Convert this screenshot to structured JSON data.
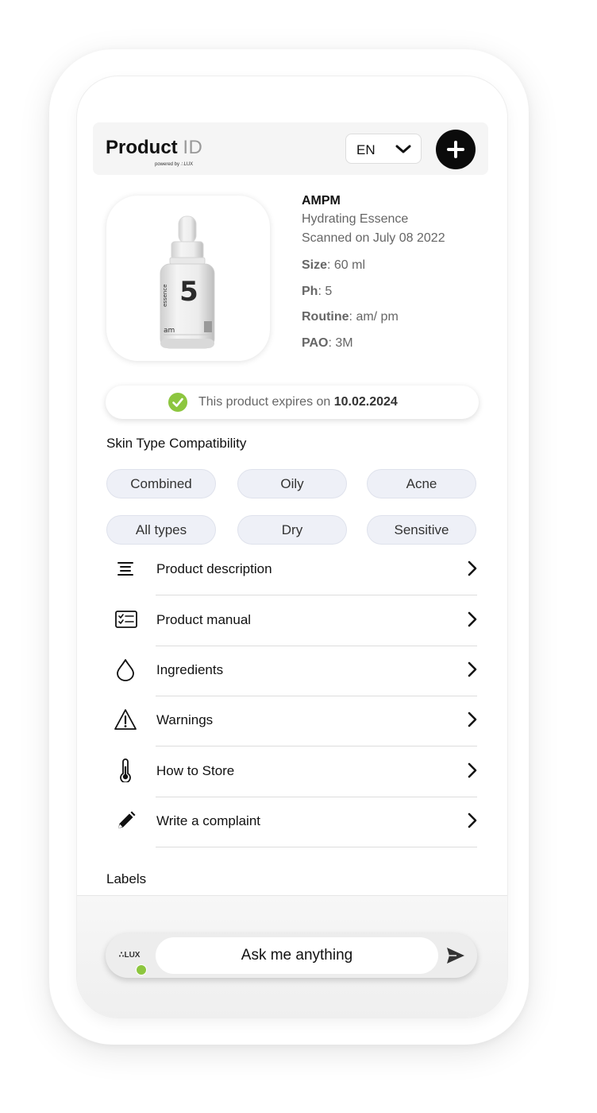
{
  "header": {
    "logo_bold": "Product",
    "logo_light": "ID",
    "powered_by": "powered by ∴LUX",
    "language": "EN"
  },
  "product": {
    "image_label_number": "5",
    "image_label_text": "essence",
    "image_label_brand": "am",
    "brand": "AMPM",
    "name": "Hydrating Essence",
    "scanned": "Scanned on July 08 2022",
    "specs": [
      {
        "key": "Size",
        "value": ": 60 ml"
      },
      {
        "key": "Ph",
        "value": ": 5"
      },
      {
        "key": "Routine",
        "value": ": am/ pm"
      },
      {
        "key": "PAO",
        "value": ": 3M"
      }
    ]
  },
  "expiry": {
    "message": "This product expires on ",
    "date": "10.02.2024",
    "status_color": "#8dc63f"
  },
  "skin_type": {
    "title": "Skin Type Compatibility",
    "chips": [
      "Combined",
      "Oily",
      "Acne",
      "All types",
      "Dry",
      "Sensitive"
    ]
  },
  "menu": [
    {
      "label": "Product description",
      "icon": "list-lines-icon"
    },
    {
      "label": "Product manual",
      "icon": "checklist-icon"
    },
    {
      "label": "Ingredients",
      "icon": "drop-icon"
    },
    {
      "label": "Warnings",
      "icon": "warning-icon"
    },
    {
      "label": "How to Store",
      "icon": "thermometer-icon"
    },
    {
      "label": "Write a complaint",
      "icon": "pencil-icon"
    }
  ],
  "labels_title": "Labels",
  "chat": {
    "badge": "∴LUX",
    "placeholder": "Ask me anything",
    "online_color": "#8dc63f"
  }
}
